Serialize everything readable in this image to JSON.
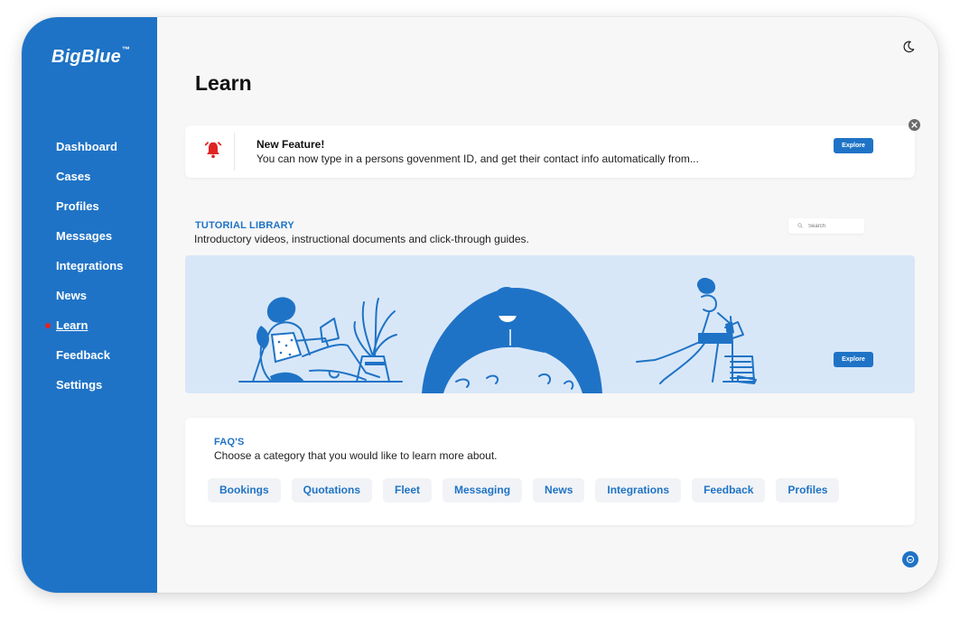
{
  "app": {
    "logo": "BigBlue",
    "trademark": "™"
  },
  "sidebar": {
    "items": [
      {
        "label": "Dashboard",
        "active": false
      },
      {
        "label": "Cases",
        "active": false
      },
      {
        "label": "Profiles",
        "active": false
      },
      {
        "label": "Messages",
        "active": false
      },
      {
        "label": "Integrations",
        "active": false
      },
      {
        "label": "News",
        "active": false
      },
      {
        "label": "Learn",
        "active": true
      },
      {
        "label": "Feedback",
        "active": false
      },
      {
        "label": "Settings",
        "active": false
      }
    ]
  },
  "header": {
    "title": "Learn",
    "theme_icon": "moon-icon"
  },
  "feature_banner": {
    "icon": "bell-icon",
    "title": "New Feature!",
    "text": "You can now type in a persons govenment ID, and get their contact info automatically from...",
    "button": "Explore",
    "close_icon": "close-icon"
  },
  "tutorial": {
    "title": "TUTORIAL LIBRARY",
    "subtitle": "Introductory videos, instructional documents and click-through guides.",
    "search_placeholder": "Search",
    "button": "Explore"
  },
  "faq": {
    "title": "FAQ'S",
    "subtitle": "Choose a category that you would like to learn more about.",
    "categories": [
      "Bookings",
      "Quotations",
      "Fleet",
      "Messaging",
      "News",
      "Integrations",
      "Feedback",
      "Profiles"
    ]
  },
  "colors": {
    "brand": "#1f73c6",
    "alert": "#e02424",
    "banner_bg": "#d8e7f8"
  }
}
